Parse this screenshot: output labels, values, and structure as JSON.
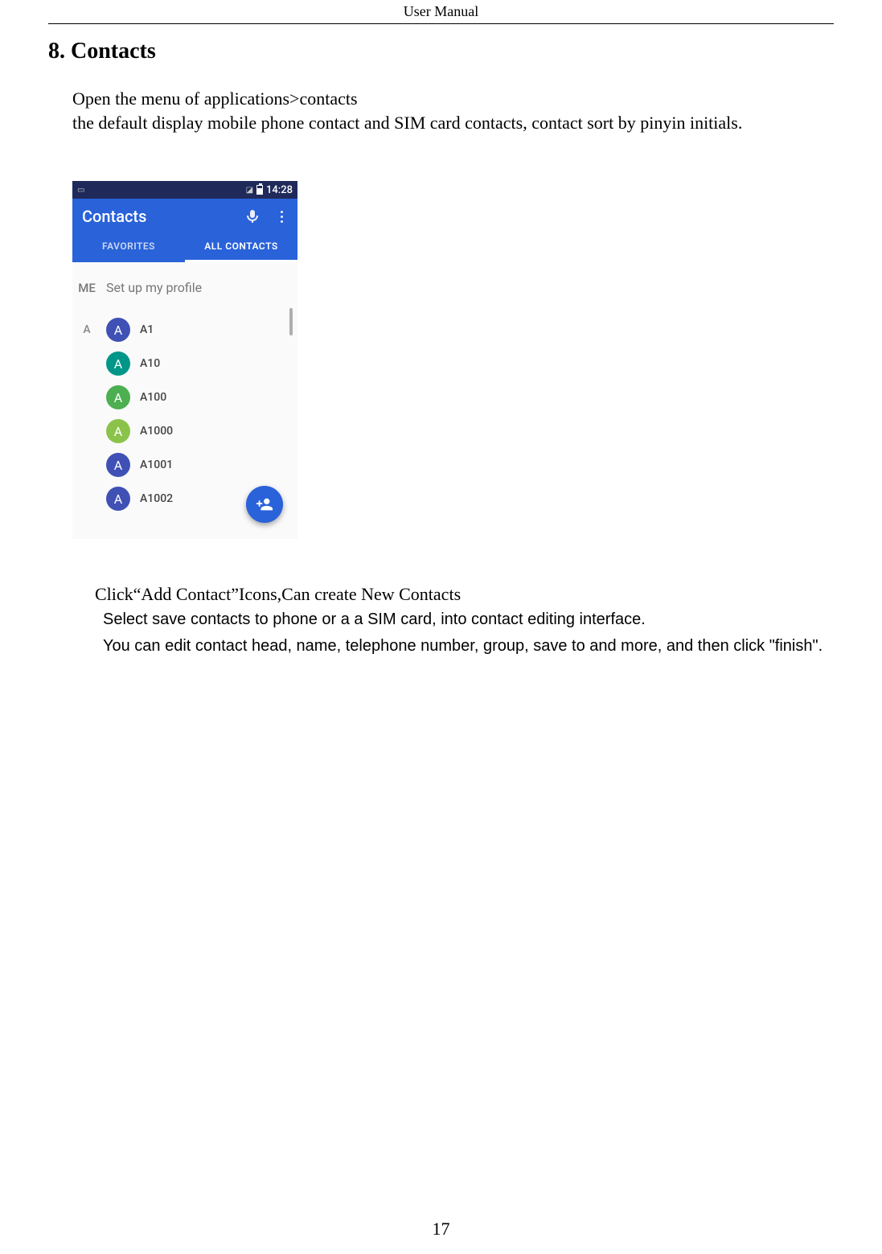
{
  "doc": {
    "header": "User    Manual",
    "heading": "8. Contacts",
    "p1": "Open the menu of applications>contacts",
    "p2": "the default display mobile phone contact and SIM card contacts, contact sort by pinyin initials.",
    "click_line": "Click“Add    Contact”Icons,Can create New Contacts",
    "sub1": "Select save contacts to phone or a a SIM card, into contact editing interface.",
    "sub2": "You can edit contact head, name, telephone number, group, save to and more, and then click \"finish\".",
    "page_number": "17"
  },
  "screenshot": {
    "status": {
      "time": "14:28"
    },
    "app_title": "Contacts",
    "tabs": {
      "favorites": "FAVORITES",
      "all": "ALL CONTACTS"
    },
    "me": {
      "label": "ME",
      "text": "Set up my profile"
    },
    "section_letter": "A",
    "contacts": [
      {
        "name": "A1",
        "avatar": "A",
        "color": "av-blue"
      },
      {
        "name": "A10",
        "avatar": "A",
        "color": "av-teal"
      },
      {
        "name": "A100",
        "avatar": "A",
        "color": "av-green"
      },
      {
        "name": "A1000",
        "avatar": "A",
        "color": "av-lime"
      },
      {
        "name": "A1001",
        "avatar": "A",
        "color": "av-blue"
      },
      {
        "name": "A1002",
        "avatar": "A",
        "color": "av-blue"
      }
    ]
  }
}
